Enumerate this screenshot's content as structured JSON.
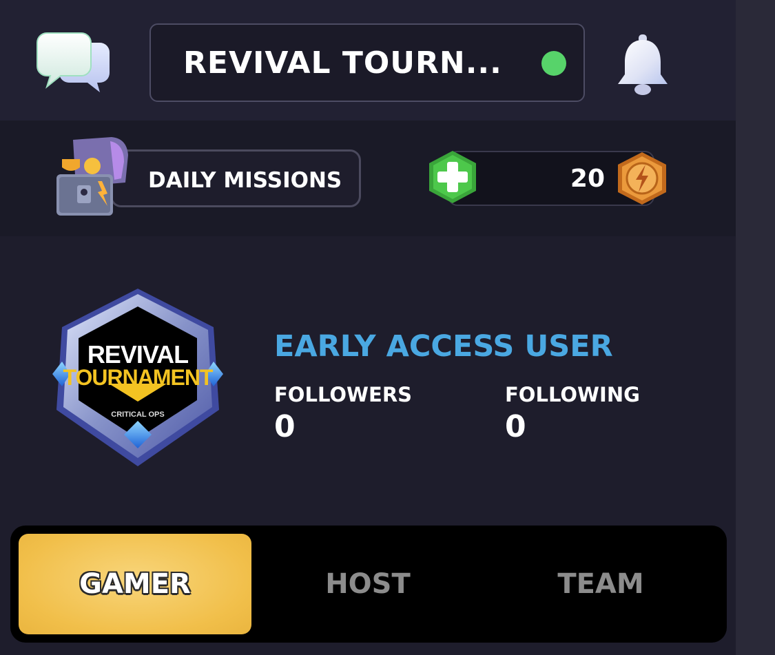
{
  "header": {
    "title": "REVIVAL TOURN...",
    "status": "online"
  },
  "missions": {
    "label": "DAILY MISSIONS"
  },
  "currency": {
    "amount": "20"
  },
  "profile": {
    "badge_logo": "REVIVAL TOURNAMENT",
    "badge_subtext": "CRITICAL OPS",
    "rank": "EARLY ACCESS USER",
    "followers_label": "FOLLOWERS",
    "followers_value": "0",
    "following_label": "FOLLOWING",
    "following_value": "0"
  },
  "tabs": [
    {
      "label": "GAMER",
      "active": true
    },
    {
      "label": "HOST",
      "active": false
    },
    {
      "label": "TEAM",
      "active": false
    }
  ],
  "colors": {
    "background": "#1e1d2c",
    "accent_blue": "#4aa8e2",
    "status_green": "#57d36a",
    "active_tab": "#f1bf4a"
  },
  "icons": [
    "chat-bubbles-icon",
    "bell-icon",
    "treasure-chest-icon",
    "plus-icon",
    "lightning-coin-icon",
    "revival-tournament-badge"
  ]
}
